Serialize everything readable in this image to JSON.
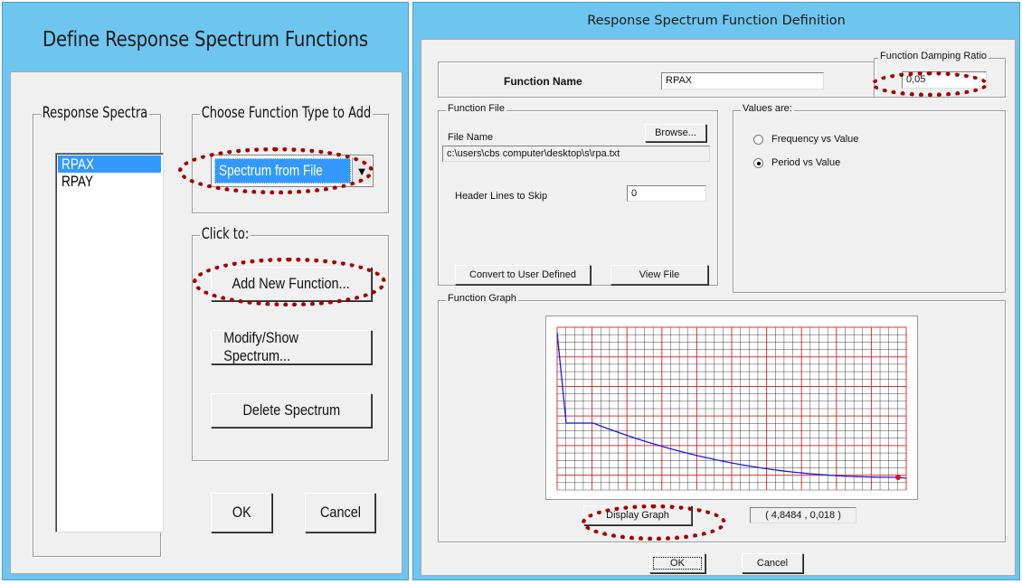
{
  "left_dialog": {
    "title": "Define Response Spectrum Functions",
    "spectra_group_label": "Response Spectra",
    "spectra": [
      "RPAX",
      "RPAY"
    ],
    "selected_spectrum": "RPAX",
    "type_group_label": "Choose  Function Type to Add",
    "function_type": "Spectrum from File",
    "click_group_label": "Click to:",
    "add_button": "Add New Function...",
    "modify_button": "Modify/Show Spectrum...",
    "delete_button": "Delete Spectrum",
    "ok_button": "OK",
    "cancel_button": "Cancel"
  },
  "right_dialog": {
    "title": "Response Spectrum  Function Definition",
    "function_name_label": "Function Name",
    "function_name": "RPAX",
    "damping_label": "Function Damping Ratio",
    "damping_value": "0,05",
    "file_group_label": "Function File",
    "file_name_label": "File Name",
    "browse_button": "Browse...",
    "file_path": "c:\\users\\cbs computer\\desktop\\s\\rpa.txt",
    "header_lines_label": "Header Lines to Skip",
    "header_lines": "0",
    "convert_button": "Convert to User Defined",
    "view_file_button": "View File",
    "values_group_label": "Values are:",
    "radio_options": [
      "Frequency vs Value",
      "Period vs Value"
    ],
    "selected_radio": "Period vs Value",
    "graph_group_label": "Function Graph",
    "display_graph_button": "Display Graph",
    "coordinate_readout": "( 4,8484  ,  0,018 )",
    "ok_button": "OK",
    "cancel_button": "Cancel"
  },
  "colors": {
    "title_bar": "#6ec6ef",
    "selection": "#3399ff",
    "highlight_oval": "#a40000",
    "grid_major": "#e03030",
    "grid_minor": "#404040",
    "curve": "#1a1ae6"
  }
}
